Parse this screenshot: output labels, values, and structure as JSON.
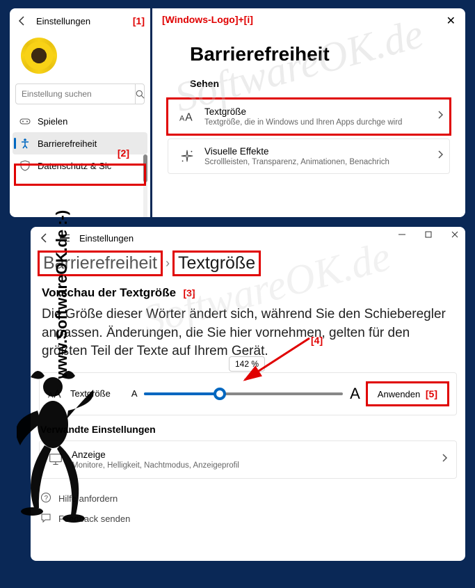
{
  "watermark": "www.SoftwareOK.de :-)",
  "watermark_wave": "SoftwareOK.de",
  "window1": {
    "back_title": "Einstellungen",
    "shortcut": "[Windows-Logo]+[i]",
    "search_placeholder": "Einstellung suchen",
    "nav": {
      "games": "Spielen",
      "accessibility": "Barrierefreiheit",
      "privacy": "Datenschutz & Sic"
    },
    "heading": "Barrierefreiheit",
    "section": "Sehen",
    "card_text": {
      "title": "Textgröße",
      "desc": "Textgröße, die in Windows und Ihren Apps durchge wird"
    },
    "card_effects": {
      "title": "Visuelle Effekte",
      "desc": "Scrollleisten, Transparenz, Animationen, Benachrich"
    }
  },
  "window2": {
    "back_title": "Einstellungen",
    "breadcrumb": {
      "parent": "Barrierefreiheit",
      "current": "Textgröße"
    },
    "preview": {
      "heading": "Vorschau der Textgröße",
      "body": "Die Größe dieser Wörter ändert sich, während Sie den Schieberegler anpassen. Änderungen, die Sie hier vornehmen, gelten für den größten Teil der Texte auf Ihrem Gerät."
    },
    "slider": {
      "label": "Textgröße",
      "value": "142 %",
      "apply": "Anwenden"
    },
    "related": {
      "heading": "Verwandte Einstellungen",
      "card_title": "Anzeige",
      "card_desc": "Monitore, Helligkeit, Nachtmodus, Anzeigeprofil"
    },
    "help": {
      "get_help": "Hilfe anfordern",
      "feedback": "Feedback senden"
    }
  },
  "annotations": {
    "a1": "[1]",
    "a2": "[2]",
    "a3": "[3]",
    "a4": "[4]",
    "a5": "[5]"
  }
}
